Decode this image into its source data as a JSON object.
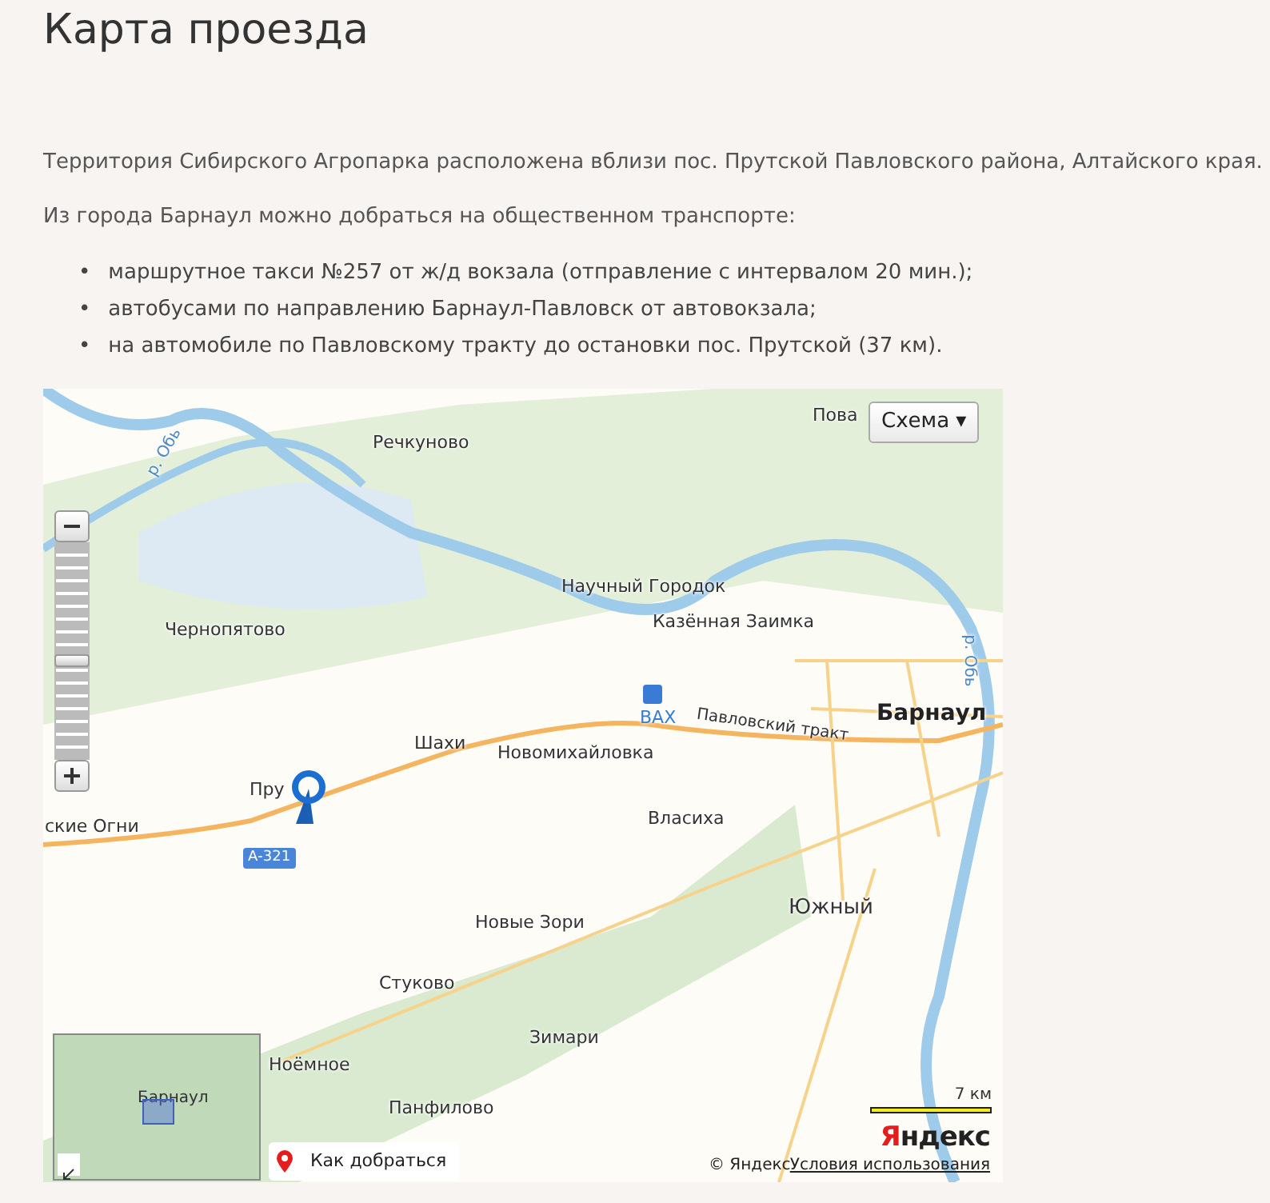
{
  "title": "Карта проезда",
  "paragraphs": [
    "Территория Сибирского Агропарка расположена вблизи пос. Прутской Павловского района, Алтайского края.",
    "Из города Барнаул можно добраться на общественном транспорте:"
  ],
  "routes": [
    {
      "marker": "•",
      "text": "маршрутное такси №257 от ж/д вокзала (отправление с интервалом 20 мин.);"
    },
    {
      "marker": "•",
      "text": "автобусами по направлению Барнаул-Павловск от автовокзала;"
    },
    {
      "marker": "•",
      "text": "на автомобиле по Павловскому тракту до остановки пос. Прутской (37 км)."
    }
  ],
  "map": {
    "type_button": "Схема ▾",
    "zoom": {
      "level": 0.46
    },
    "labels": [
      {
        "text": "Речкуново",
        "kind": "place"
      },
      {
        "text": "р. Обь",
        "kind": "river"
      },
      {
        "text": "Чернопятово",
        "kind": "place"
      },
      {
        "text": "Научный Городок",
        "kind": "place"
      },
      {
        "text": "Казённая Заимка",
        "kind": "place"
      },
      {
        "text": "ВАХ",
        "kind": "airport"
      },
      {
        "text": "Павловский тракт",
        "kind": "road"
      },
      {
        "text": "Барнаул",
        "kind": "city"
      },
      {
        "text": "Шахи",
        "kind": "place"
      },
      {
        "text": "Новомихайловка",
        "kind": "place"
      },
      {
        "text": "Пру",
        "kind": "place"
      },
      {
        "text": "ские Огни",
        "kind": "place"
      },
      {
        "text": "А-321",
        "kind": "shield"
      },
      {
        "text": "Власиха",
        "kind": "place"
      },
      {
        "text": "Новые Зори",
        "kind": "place"
      },
      {
        "text": "Южный",
        "kind": "town"
      },
      {
        "text": "Стуково",
        "kind": "place"
      },
      {
        "text": "Ноёмное",
        "kind": "place"
      },
      {
        "text": "Зимари",
        "kind": "place"
      },
      {
        "text": "Панфилово",
        "kind": "place"
      },
      {
        "text": "Пова",
        "kind": "place"
      },
      {
        "text": "р. Обь",
        "kind": "river-vertical"
      }
    ],
    "minimap_label": "Барнаул",
    "route_button": "Как добраться",
    "scale": "7 км",
    "logo": "Яндекс",
    "copyright": "© Яндекс",
    "terms_link": "Условия использования"
  }
}
